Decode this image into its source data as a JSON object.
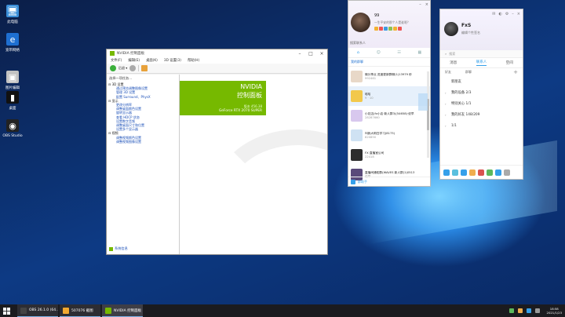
{
  "desktop": {
    "icons": [
      {
        "label": "此电脑",
        "color": "#3b8fd9",
        "glyph": "🖥"
      },
      {
        "label": "宽带网络",
        "color": "#1e6fd1",
        "glyph": "e"
      },
      {
        "label": "图片编辑",
        "color": "#c2c2c2",
        "glyph": "▣"
      },
      {
        "label": "桌面",
        "color": "#111111",
        "glyph": "▮"
      },
      {
        "label": "OBS Studio",
        "color": "#222222",
        "glyph": "◉"
      }
    ]
  },
  "nvidia": {
    "title": "NVIDIA 控制面板",
    "menu": [
      "文件(F)",
      "编辑(E)",
      "桌面(K)",
      "3D 设置(3)",
      "帮助(H)"
    ],
    "task_header": "选择一项任务...",
    "tree": [
      {
        "text": "⊟ 3D 设置",
        "indent": 2,
        "link": false
      },
      {
        "text": "通过预览调整图像设置",
        "indent": 12,
        "link": true
      },
      {
        "text": "管理 3D 设置",
        "indent": 12,
        "link": true
      },
      {
        "text": "配置 Surround、PhysX",
        "indent": 12,
        "link": true
      },
      {
        "text": "⊟ 显示",
        "indent": 2,
        "link": false
      },
      {
        "text": "更改分辨率",
        "indent": 12,
        "link": true
      },
      {
        "text": "调整桌面颜色设置",
        "indent": 12,
        "link": true
      },
      {
        "text": "旋转显示器",
        "indent": 12,
        "link": true
      },
      {
        "text": "查看 HDCP 状态",
        "indent": 12,
        "link": true
      },
      {
        "text": "设置数字音频",
        "indent": 12,
        "link": true
      },
      {
        "text": "调整桌面尺寸和位置",
        "indent": 12,
        "link": true
      },
      {
        "text": "设置多个显示器",
        "indent": 12,
        "link": true
      },
      {
        "text": "⊟ 视频",
        "indent": 2,
        "link": false
      },
      {
        "text": "调整视频颜色设置",
        "indent": 12,
        "link": true
      },
      {
        "text": "调整视频图像设置",
        "indent": 12,
        "link": true
      }
    ],
    "system_info": "系统信息",
    "banner": {
      "brand": "NVIDIA",
      "product": "控制面板",
      "version": "版本 456.38",
      "gpu": "GeForce RTX 2070 SUPER"
    }
  },
  "qq_chat": {
    "name": "99",
    "signature": "一生平安的那个人是谁呢？",
    "search_placeholder": "搜索联系人",
    "tab_label": "我的群聊",
    "chats": [
      {
        "title": "微分享点 进度更新群聊(1)13979 秒",
        "sub": "992461",
        "color": "#e8d8c8",
        "selected": false
      },
      {
        "title": "哈哈",
        "sub": "9 · 10",
        "color": "#f2c84b",
        "selected": true
      },
      {
        "title": "小花店(fx小店·新人群3)(54658)·说早",
        "sub": "28287660",
        "color": "#d8c8ee",
        "selected": false
      },
      {
        "title": "叫我大明白学习(8173)",
        "sub": "820890",
        "color": "#cfe2f3",
        "selected": false
      },
      {
        "title": "FX 直播室公司",
        "sub": "22418",
        "color": "#2d2d2d",
        "selected": false
      },
      {
        "title": "直播间通知群(WAVES 新人群(1)0513",
        "sub": "说早",
        "color": "#5a4a7a",
        "selected": false
      }
    ],
    "footer": "群助手"
  },
  "qq_contacts": {
    "name": "FxS",
    "signature": "编辑个性签名",
    "search_placeholder": "搜索",
    "tabs": [
      "消息",
      "联系人",
      "空间"
    ],
    "active_tab": 1,
    "segments": [
      "好友",
      "群聊"
    ],
    "groups": [
      {
        "label": "新朋友",
        "arrow": ""
      },
      {
        "label": "我的设备 2/3",
        "arrow": "›"
      },
      {
        "label": "特别关心 1/1",
        "arrow": "›"
      },
      {
        "label": "我的好友 148/209",
        "arrow": "›"
      },
      {
        "label": "1/1",
        "arrow": "›"
      }
    ]
  },
  "taskbar": {
    "tasks": [
      {
        "label": "OBS 26.1.0 (64...",
        "color": "#444444",
        "active": false
      },
      {
        "label": "507076 截图",
        "color": "#f0a830",
        "active": false
      },
      {
        "label": "NVIDIA 控制面板",
        "color": "#76b900",
        "active": true
      }
    ],
    "time": "18:58",
    "date": "2021/1/23"
  },
  "colors": {
    "nvidia_green": "#76b900",
    "qq_blue": "#36a0ea"
  }
}
